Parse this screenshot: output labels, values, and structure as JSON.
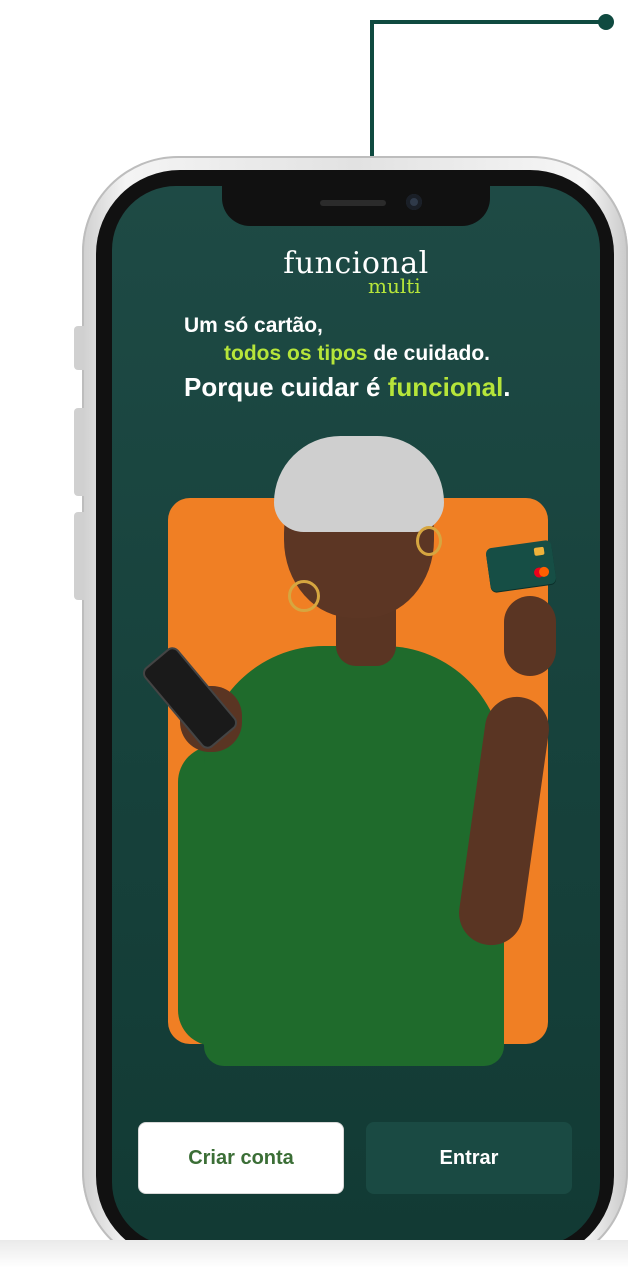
{
  "app": {
    "logo_main": "funcional",
    "logo_sub": "multi"
  },
  "headline": {
    "line1": "Um só cartão,",
    "line2_highlight": "todos os tipos",
    "line2_rest": " de cuidado.",
    "line3_start": "Porque cuidar é ",
    "line3_highlight": "funcional",
    "line3_end": "."
  },
  "buttons": {
    "create_account": "Criar conta",
    "sign_in": "Entrar"
  },
  "colors": {
    "brand_dark_green": "#17423c",
    "accent_lime": "#b6e53a",
    "hero_orange": "#f07f24",
    "callout_line": "#0f4a40"
  },
  "illustration": {
    "subject": "woman holding phone and payment card",
    "icons": [
      "smartphone-icon",
      "credit-card-icon",
      "mastercard-logo"
    ]
  }
}
